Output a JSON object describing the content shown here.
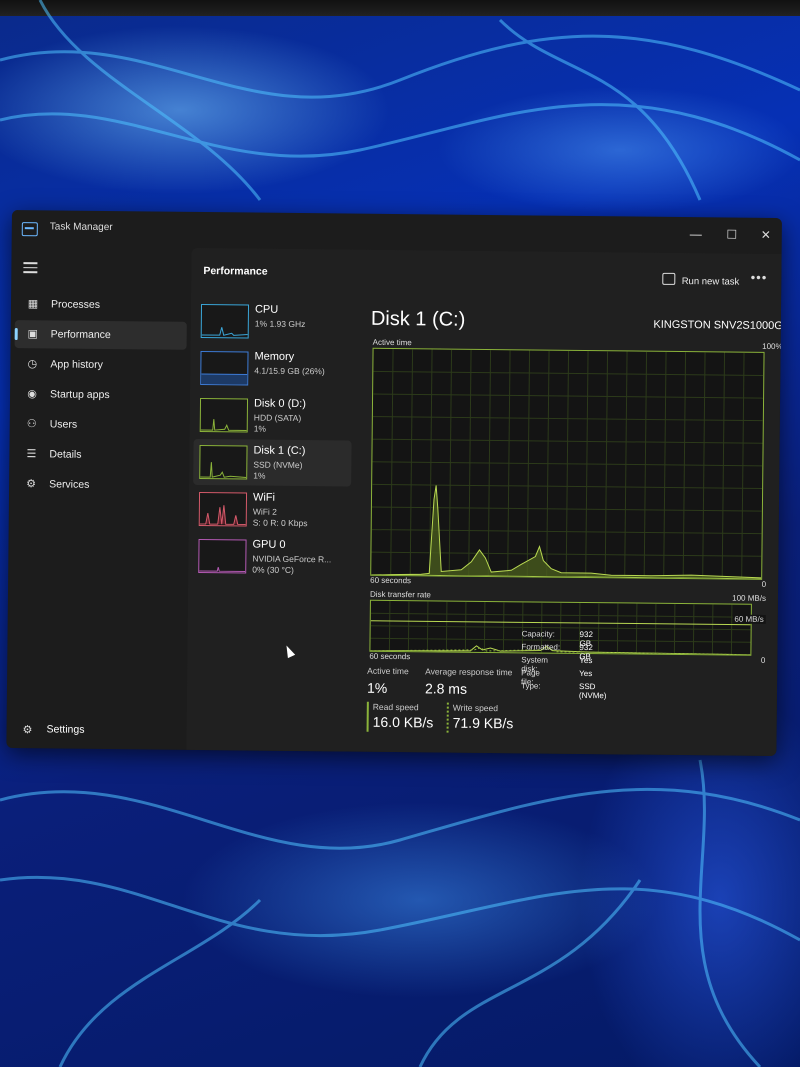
{
  "window": {
    "title": "Task Manager",
    "minimize": "—",
    "maximize": "☐",
    "close": "✕"
  },
  "nav": {
    "items": [
      {
        "label": "Processes",
        "icon": "processes-icon"
      },
      {
        "label": "Performance",
        "icon": "performance-icon",
        "active": true
      },
      {
        "label": "App history",
        "icon": "app-history-icon"
      },
      {
        "label": "Startup apps",
        "icon": "startup-apps-icon"
      },
      {
        "label": "Users",
        "icon": "users-icon"
      },
      {
        "label": "Details",
        "icon": "details-icon"
      },
      {
        "label": "Services",
        "icon": "services-icon"
      }
    ],
    "settings": "Settings"
  },
  "header": {
    "title": "Performance",
    "run_new_task": "Run new task",
    "more": "•••"
  },
  "devices": [
    {
      "name": "CPU",
      "line2": "1% 1.93 GHz",
      "line3": "",
      "color": "#3aa6d8"
    },
    {
      "name": "Memory",
      "line2": "4.1/15.9 GB (26%)",
      "line3": "",
      "color": "#3d7bd6"
    },
    {
      "name": "Disk 0 (D:)",
      "line2": "HDD (SATA)",
      "line3": "1%",
      "color": "#8bb33a"
    },
    {
      "name": "Disk 1 (C:)",
      "line2": "SSD (NVMe)",
      "line3": "1%",
      "color": "#8bb33a",
      "active": true
    },
    {
      "name": "WiFi",
      "line2": "WiFi 2",
      "line3": "S: 0 R: 0 Kbps",
      "color": "#d45a6a"
    },
    {
      "name": "GPU 0",
      "line2": "NVIDIA GeForce R...",
      "line3": "0% (30 °C)",
      "color": "#b45ab4"
    }
  ],
  "detail": {
    "title": "Disk 1 (C:)",
    "model": "KINGSTON SNV2S1000G",
    "active_time_label": "Active time",
    "active_time_max": "100%",
    "active_time_xlabel": "60 seconds",
    "active_time_xmin": "0",
    "transfer_label": "Disk transfer rate",
    "transfer_max": "100 MB/s",
    "transfer_line_label": "60 MB/s",
    "transfer_xlabel": "60 seconds",
    "transfer_xmin": "0"
  },
  "stats": {
    "active_time_label": "Active time",
    "active_time_value": "1%",
    "avg_response_label": "Average response time",
    "avg_response_value": "2.8 ms",
    "read_speed_label": "Read speed",
    "read_speed_value": "16.0 KB/s",
    "write_speed_label": "Write speed",
    "write_speed_value": "71.9 KB/s"
  },
  "properties": [
    {
      "key": "Capacity:",
      "value": "932 GB"
    },
    {
      "key": "Formatted:",
      "value": "932 GB"
    },
    {
      "key": "System disk:",
      "value": "Yes"
    },
    {
      "key": "Page file:",
      "value": "Yes"
    },
    {
      "key": "Type:",
      "value": "SSD (NVMe)"
    }
  ],
  "colors": {
    "disk_green": "#8bb33a",
    "accent": "#8cd3ff"
  }
}
